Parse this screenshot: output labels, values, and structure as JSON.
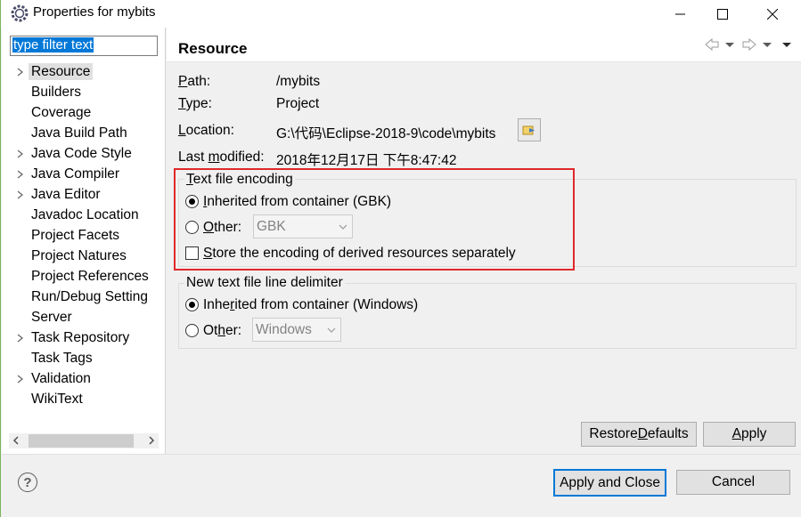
{
  "window": {
    "title": "Properties for mybits",
    "icon": "eclipse-gear-icon"
  },
  "filter": {
    "value": "type filter text"
  },
  "tree": {
    "items": [
      {
        "label": "Resource",
        "expandable": true,
        "selected": true
      },
      {
        "label": "Builders",
        "expandable": false
      },
      {
        "label": "Coverage",
        "expandable": false
      },
      {
        "label": "Java Build Path",
        "expandable": false
      },
      {
        "label": "Java Code Style",
        "expandable": true
      },
      {
        "label": "Java Compiler",
        "expandable": true
      },
      {
        "label": "Java Editor",
        "expandable": true
      },
      {
        "label": "Javadoc Location",
        "expandable": false
      },
      {
        "label": "Project Facets",
        "expandable": false
      },
      {
        "label": "Project Natures",
        "expandable": false
      },
      {
        "label": "Project References",
        "expandable": false
      },
      {
        "label": "Run/Debug Setting",
        "expandable": false
      },
      {
        "label": "Server",
        "expandable": false
      },
      {
        "label": "Task Repository",
        "expandable": true
      },
      {
        "label": "Task Tags",
        "expandable": false
      },
      {
        "label": "Validation",
        "expandable": true
      },
      {
        "label": "WikiText",
        "expandable": false
      }
    ]
  },
  "page": {
    "title": "Resource",
    "path_label": "Path:",
    "path_value": "/mybits",
    "type_label": "Type:",
    "type_value": "Project",
    "location_label": "Location:",
    "location_value": "G:\\代码\\Eclipse-2018-9\\code\\mybits",
    "modified_label": "Last modified:",
    "modified_value": "2018年12月17日 下午8:47:42"
  },
  "encoding": {
    "group_title": "Text file encoding",
    "inherited_label": "Inherited from container (GBK)",
    "other_label": "Other:",
    "other_value": "GBK",
    "store_label": "Store the encoding of derived resources separately"
  },
  "delimiter": {
    "group_title": "New text file line delimiter",
    "inherited_label": "Inherited from container (Windows)",
    "other_label": "Other:",
    "other_value": "Windows"
  },
  "buttons": {
    "restore_defaults": "Restore Defaults",
    "apply": "Apply",
    "apply_and_close": "Apply and Close",
    "cancel": "Cancel"
  },
  "colors": {
    "highlight_box": "#e0282b",
    "selection": "#0078d7"
  }
}
